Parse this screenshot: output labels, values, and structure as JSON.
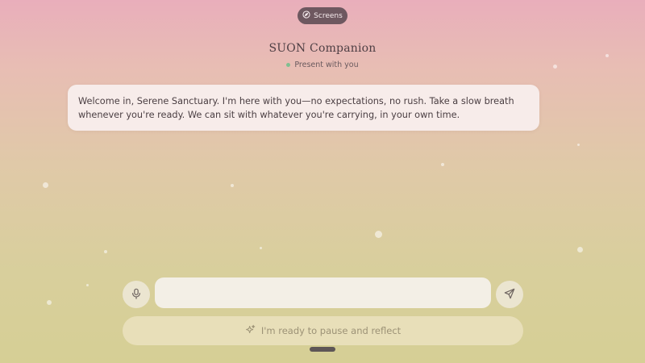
{
  "nav": {
    "screens_label": "Screens",
    "screens_icon": "compass-icon"
  },
  "header": {
    "title": "SUON Companion",
    "status": "Present with you",
    "status_color": "#7fbf90"
  },
  "conversation": {
    "messages": [
      {
        "sender": "companion",
        "text": "Welcome in, Serene Sanctuary. I'm here with you—no expectations, no rush. Take a slow breath whenever you're ready. We can sit with whatever you're carrying, in your own time."
      }
    ]
  },
  "composer": {
    "input_value": "",
    "placeholder": "",
    "mic_icon": "microphone-icon",
    "send_icon": "send-icon"
  },
  "quick_action": {
    "label": "I'm ready to pause and reflect",
    "icon": "sparkles-icon"
  },
  "colors": {
    "gradient_top": "#e9aebb",
    "gradient_bottom": "#d6cf95",
    "bubble": "#f7ecea",
    "pill": "#6e5860"
  }
}
